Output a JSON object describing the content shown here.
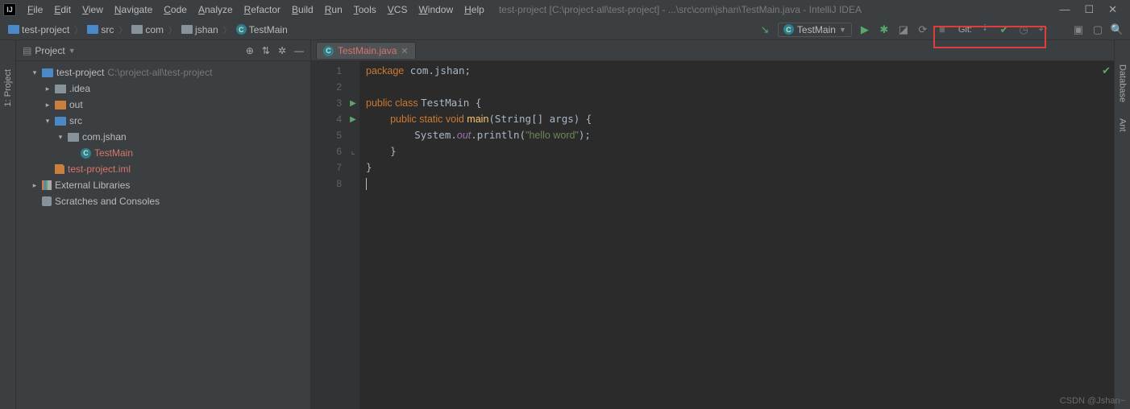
{
  "title_bar": {
    "app": "IntelliJ IDEA",
    "path": "test-project [C:\\project-all\\test-project] - ...\\src\\com\\jshan\\TestMain.java"
  },
  "menus": [
    "File",
    "Edit",
    "View",
    "Navigate",
    "Code",
    "Analyze",
    "Refactor",
    "Build",
    "Run",
    "Tools",
    "VCS",
    "Window",
    "Help"
  ],
  "breadcrumbs": [
    {
      "icon": "folder-blue",
      "label": "test-project"
    },
    {
      "icon": "folder-blue",
      "label": "src"
    },
    {
      "icon": "folder",
      "label": "com"
    },
    {
      "icon": "folder",
      "label": "jshan"
    },
    {
      "icon": "class",
      "label": "TestMain"
    }
  ],
  "run_config": "TestMain",
  "git_label": "Git:",
  "project_panel": {
    "title": "Project",
    "tree": [
      {
        "depth": 0,
        "arrow": "▾",
        "icon": "folder-blue",
        "label": "test-project",
        "suffix": "C:\\project-all\\test-project"
      },
      {
        "depth": 1,
        "arrow": "▸",
        "icon": "folder",
        "label": ".idea"
      },
      {
        "depth": 1,
        "arrow": "▸",
        "icon": "folder-orange",
        "label": "out"
      },
      {
        "depth": 1,
        "arrow": "▾",
        "icon": "folder-blue",
        "label": "src"
      },
      {
        "depth": 2,
        "arrow": "▾",
        "icon": "folder",
        "label": "com.jshan"
      },
      {
        "depth": 3,
        "arrow": "",
        "icon": "class",
        "label": "TestMain",
        "sel": true
      },
      {
        "depth": 1,
        "arrow": "",
        "icon": "iml",
        "label": "test-project.iml",
        "sel": true
      },
      {
        "depth": -1,
        "arrow": "▸",
        "icon": "lib",
        "label": "External Libraries"
      },
      {
        "depth": -1,
        "arrow": "",
        "icon": "scratch",
        "label": "Scratches and Consoles"
      }
    ]
  },
  "tabs": [
    {
      "label": "TestMain.java"
    }
  ],
  "code": {
    "lines": [
      1,
      2,
      3,
      4,
      5,
      6,
      7,
      8
    ],
    "gutter_marks": {
      "3": "▶",
      "4": "▶"
    },
    "fold_marks": {
      "4": "⊟",
      "6": "⌞"
    },
    "text": [
      {
        "t": "package",
        "c": "kw"
      },
      {
        "t": " com.jshan"
      },
      {
        "t": ";"
      },
      {
        "br": 1
      },
      {
        "br": 1
      },
      {
        "t": "public class ",
        "c": "kw"
      },
      {
        "t": "TestMain {"
      },
      {
        "br": 1
      },
      {
        "t": "    "
      },
      {
        "t": "public static void ",
        "c": "kw"
      },
      {
        "t": "main",
        "c": "mth"
      },
      {
        "t": "(String[] args) {"
      },
      {
        "br": 1
      },
      {
        "t": "        System."
      },
      {
        "t": "out",
        "c": "fld"
      },
      {
        "t": ".println("
      },
      {
        "t": "\"hello word\"",
        "c": "str"
      },
      {
        "t": ");"
      },
      {
        "br": 1
      },
      {
        "t": "    }"
      },
      {
        "br": 1
      },
      {
        "t": "}"
      },
      {
        "br": 1
      }
    ]
  },
  "side_tabs": {
    "left": "1: Project",
    "right": [
      "Database",
      "Ant"
    ]
  },
  "watermark": "CSDN @Jshan~"
}
